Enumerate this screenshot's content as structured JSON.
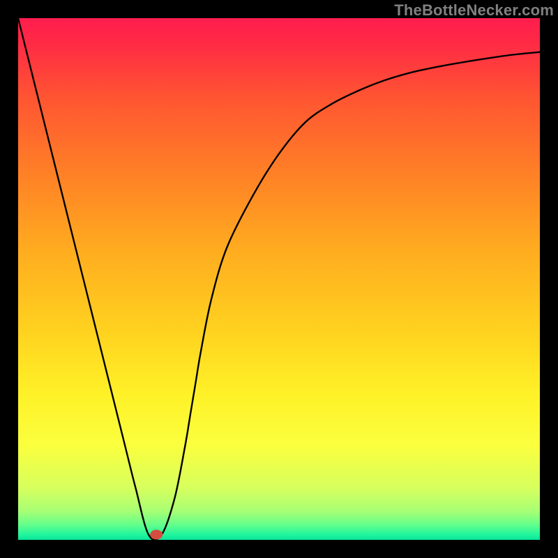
{
  "attribution": "TheBottleNecker.com",
  "chart_data": {
    "type": "line",
    "title": "",
    "xlabel": "",
    "ylabel": "",
    "xlim": [
      0,
      100
    ],
    "ylim": [
      0,
      100
    ],
    "note": "Unlabeled chart. Numbers are normalized 0–100 estimates of the visible curve. Plot frame is ~26px from each edge; outer border is black.",
    "series": [
      {
        "name": "curve",
        "x": [
          0,
          5,
          10,
          15,
          20,
          22.5,
          25,
          27.5,
          30,
          32,
          33,
          34,
          35,
          37,
          40,
          45,
          50,
          55,
          60,
          65,
          70,
          75,
          80,
          85,
          90,
          95,
          100
        ],
        "y": [
          100,
          80,
          60,
          40,
          20,
          10,
          1,
          1,
          8,
          18,
          24,
          30,
          36,
          46,
          56,
          66,
          74,
          80,
          83.5,
          86,
          88,
          89.5,
          90.6,
          91.5,
          92.3,
          93,
          93.5
        ]
      }
    ],
    "marker": {
      "x": 26.5,
      "y": 1,
      "color": "#d64d3f"
    },
    "gradient_stops": [
      {
        "offset": 0,
        "color": "#ff1d4e"
      },
      {
        "offset": 0.05,
        "color": "#ff2b45"
      },
      {
        "offset": 0.15,
        "color": "#ff5432"
      },
      {
        "offset": 0.3,
        "color": "#ff8126"
      },
      {
        "offset": 0.45,
        "color": "#ffad1f"
      },
      {
        "offset": 0.6,
        "color": "#ffd21f"
      },
      {
        "offset": 0.72,
        "color": "#fff128"
      },
      {
        "offset": 0.82,
        "color": "#faff3e"
      },
      {
        "offset": 0.9,
        "color": "#d7ff5d"
      },
      {
        "offset": 0.945,
        "color": "#a7ff74"
      },
      {
        "offset": 0.97,
        "color": "#66ff8a"
      },
      {
        "offset": 0.99,
        "color": "#22f59d"
      },
      {
        "offset": 1.0,
        "color": "#07e49a"
      }
    ]
  },
  "colors": {
    "frame_border": "#000000",
    "curve": "#000000",
    "marker": "#d64d3f"
  }
}
